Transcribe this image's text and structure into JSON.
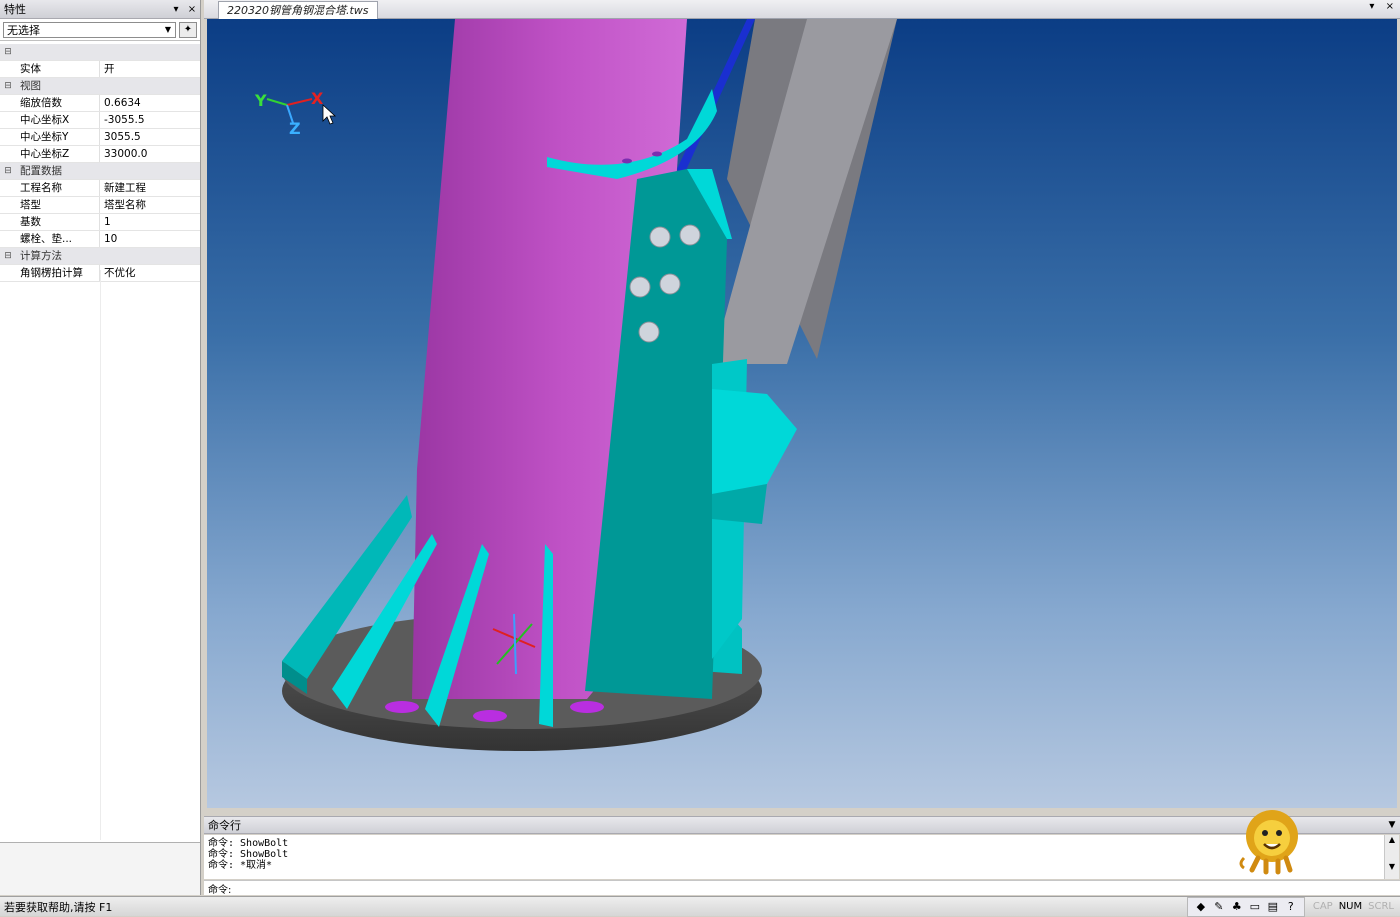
{
  "properties_panel": {
    "title": "特性",
    "pin_glyph": "▾",
    "close_glyph": "×",
    "selector": {
      "value": "无选择"
    },
    "rows": [
      {
        "type": "cat",
        "toggle": "⊟",
        "key": "",
        "value": ""
      },
      {
        "type": "item",
        "key": "实体",
        "value": "开"
      },
      {
        "type": "cat",
        "toggle": "⊟",
        "key": "视图",
        "value": ""
      },
      {
        "type": "item",
        "key": "缩放倍数",
        "value": "0.6634"
      },
      {
        "type": "item",
        "key": "中心坐标X",
        "value": "-3055.5"
      },
      {
        "type": "item",
        "key": "中心坐标Y",
        "value": "3055.5"
      },
      {
        "type": "item",
        "key": "中心坐标Z",
        "value": "33000.0"
      },
      {
        "type": "cat",
        "toggle": "⊟",
        "key": "配置数据",
        "value": ""
      },
      {
        "type": "item",
        "key": "工程名称",
        "value": "新建工程"
      },
      {
        "type": "item",
        "key": "塔型",
        "value": "塔型名称"
      },
      {
        "type": "item",
        "key": "基数",
        "value": "1"
      },
      {
        "type": "item",
        "key": "螺栓、垫...",
        "value": "10"
      },
      {
        "type": "cat",
        "toggle": "⊟",
        "key": "计算方法",
        "value": ""
      },
      {
        "type": "item",
        "key": "角钢楞拍计算",
        "value": "不优化"
      }
    ]
  },
  "document": {
    "tab_label": "220320钢管角钢混合塔.tws",
    "pin_glyph": "▾",
    "close_glyph": "×"
  },
  "viewport": {
    "axes": {
      "y": "Y",
      "x": "X",
      "z": "Z"
    },
    "colors": {
      "tube": "#c052c6",
      "plate": "#00d8d8",
      "plate_dark": "#009d9a",
      "base": "#4d4d4d",
      "angle": "#8f8f95",
      "bg_top": "#0b3d85",
      "bg_bottom": "#b6c8e0"
    }
  },
  "command_panel": {
    "title": "命令行",
    "history": [
      "命令: ShowBolt",
      "命令: ShowBolt",
      "命令: *取消*"
    ],
    "prompt": "命令:",
    "input_value": ""
  },
  "status_bar": {
    "message": "若要获取帮助,请按 F1",
    "tray_icons": [
      "diamond-icon",
      "pen-icon",
      "leaf-icon",
      "keyboard-icon",
      "calendar-icon",
      "help-icon"
    ],
    "tray_glyphs": [
      "◆",
      "✎",
      "♣",
      "▭",
      "▤",
      "?"
    ],
    "indicators": {
      "cap": "CAP",
      "num": "NUM",
      "scrl": "SCRL"
    }
  }
}
